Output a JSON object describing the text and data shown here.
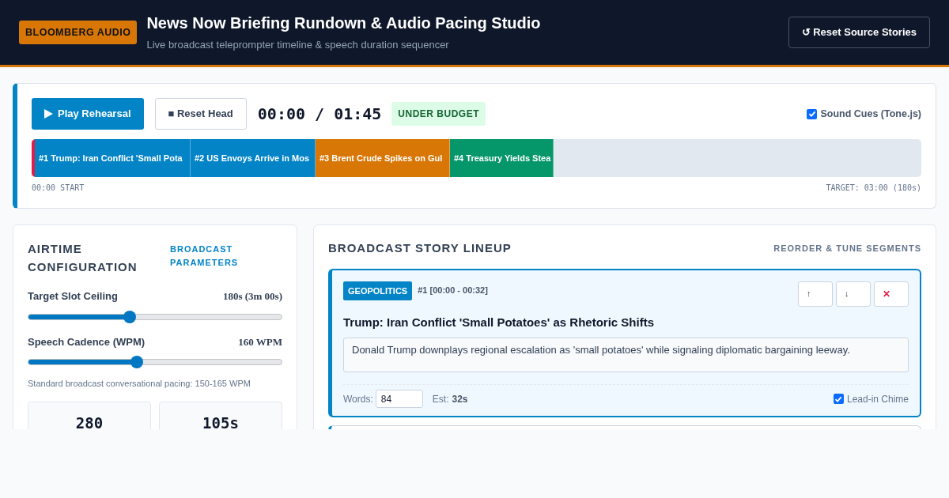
{
  "header": {
    "badge": "BLOOMBERG AUDIO",
    "title": "News Now Briefing Rundown & Audio Pacing Studio",
    "subtitle": "Live broadcast teleprompter timeline & speech duration sequencer",
    "reset_button": "↺ Reset Source Stories"
  },
  "transport": {
    "play_button": "Play Rehearsal",
    "reset_button": "■ Reset Head",
    "clock": "00:00 / 01:45",
    "status_badge": "UNDER BUDGET",
    "sound_cues": {
      "label": "Sound Cues (Tone.js)",
      "checked": true
    },
    "timeline": {
      "start_label": "00:00 START",
      "target_label": "TARGET: 03:00 (180s)",
      "segments": [
        {
          "label": "#1 Trump: Iran Conflict 'Small Pota",
          "color": "#0284c7"
        },
        {
          "label": "#2 US Envoys Arrive in Mos",
          "color": "#0284c7"
        },
        {
          "label": "#3 Brent Crude Spikes on Gul",
          "color": "#d97706"
        },
        {
          "label": "#4 Treasury Yields Stea",
          "color": "#059669"
        }
      ]
    }
  },
  "config": {
    "title": "AIRTIME CONFIGURATION",
    "tag": "BROADCAST PARAMETERS",
    "sliders": [
      {
        "label": "Target Slot Ceiling",
        "reading": "180s (3m 00s)",
        "level": 0.4
      },
      {
        "label": "Speech Cadence (WPM)",
        "reading": "160 WPM",
        "level": 0.43
      }
    ],
    "hint": "Standard broadcast conversational pacing: 150-165 WPM",
    "stats": [
      "280",
      "105s"
    ]
  },
  "lineup": {
    "title": "BROADCAST STORY LINEUP",
    "tag": "REORDER & TUNE SEGMENTS",
    "stories": [
      {
        "category": "GEOPOLITICS",
        "slot": "#1 [00:00 - 00:32]",
        "selected": true,
        "up": "↑",
        "down": "↓",
        "remove": "✕",
        "headline": "Trump: Iran Conflict 'Small Potatoes' as Rhetoric Shifts",
        "summary": "Donald Trump downplays regional escalation as 'small potatoes' while signaling diplomatic bargaining leeway.",
        "words_label": "Words:",
        "words": "84",
        "est_label": "Est:",
        "est": "32s",
        "chime": {
          "label": "Lead-in Chime",
          "checked": true
        }
      }
    ]
  }
}
